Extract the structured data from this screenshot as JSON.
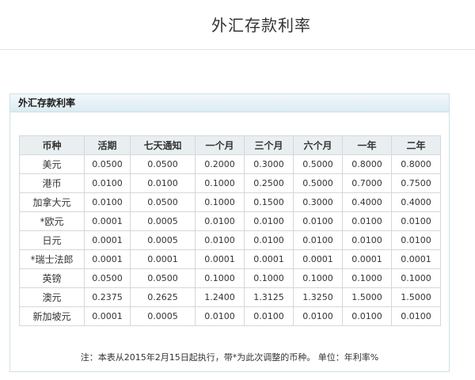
{
  "page": {
    "title": "外汇存款利率"
  },
  "panel": {
    "title": "外汇存款利率"
  },
  "table": {
    "headers": [
      "币种",
      "活期",
      "七天通知",
      "一个月",
      "三个月",
      "六个月",
      "一年",
      "二年"
    ],
    "rows": [
      [
        "美元",
        "0.0500",
        "0.0500",
        "0.2000",
        "0.3000",
        "0.5000",
        "0.8000",
        "0.8000"
      ],
      [
        "港币",
        "0.0100",
        "0.0100",
        "0.1000",
        "0.2500",
        "0.5000",
        "0.7000",
        "0.7500"
      ],
      [
        "加拿大元",
        "0.0100",
        "0.0500",
        "0.1000",
        "0.1500",
        "0.3000",
        "0.4000",
        "0.4000"
      ],
      [
        "*欧元",
        "0.0001",
        "0.0005",
        "0.0100",
        "0.0100",
        "0.0100",
        "0.0100",
        "0.0100"
      ],
      [
        "日元",
        "0.0001",
        "0.0005",
        "0.0100",
        "0.0100",
        "0.0100",
        "0.0100",
        "0.0100"
      ],
      [
        "*瑞士法郎",
        "0.0001",
        "0.0001",
        "0.0001",
        "0.0001",
        "0.0001",
        "0.0001",
        "0.0001"
      ],
      [
        "英镑",
        "0.0500",
        "0.0500",
        "0.1000",
        "0.1000",
        "0.1000",
        "0.1000",
        "0.1000"
      ],
      [
        "澳元",
        "0.2375",
        "0.2625",
        "1.2400",
        "1.3125",
        "1.3250",
        "1.5000",
        "1.5000"
      ],
      [
        "新加坡元",
        "0.0001",
        "0.0005",
        "0.0100",
        "0.0100",
        "0.0100",
        "0.0100",
        "0.0100"
      ]
    ]
  },
  "note": "注：本表从2015年2月15日起执行，带*为此次调整的币种。  单位：年利率%"
}
